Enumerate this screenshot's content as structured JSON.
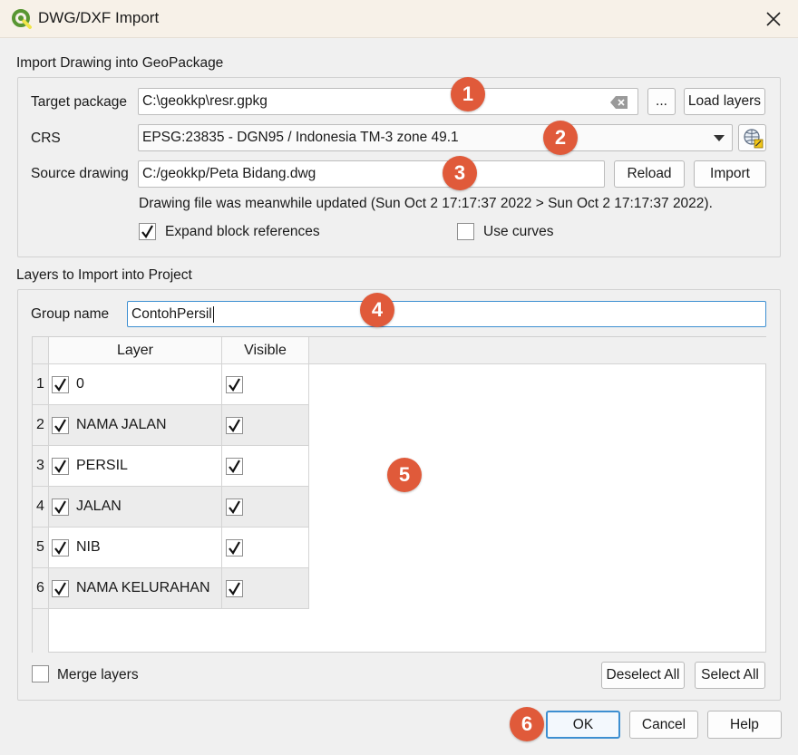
{
  "window": {
    "title": "DWG/DXF Import"
  },
  "icons": {
    "app": "qgis-logo-icon",
    "close": "close-icon",
    "clear": "clear-text-icon",
    "dropdown": "chevron-down-icon",
    "crs_select": "globe-crs-icon",
    "check": "checkmark-icon"
  },
  "colors": {
    "accent": "#3d8fd1",
    "badge": "#e05a3a",
    "qgis_green": "#589632"
  },
  "import_drawing": {
    "title": "Import Drawing into GeoPackage",
    "target_package_label": "Target package",
    "target_package_value": "C:\\geokkp\\resr.gpkg",
    "browse_label": "...",
    "load_layers_label": "Load layers",
    "crs_label": "CRS",
    "crs_value": "EPSG:23835 - DGN95 / Indonesia TM-3 zone 49.1",
    "source_drawing_label": "Source drawing",
    "source_drawing_value": "C:/geokkp/Peta Bidang.dwg",
    "reload_label": "Reload",
    "import_label": "Import",
    "status_message": "Drawing file was meanwhile updated (Sun Oct 2 17:17:37 2022 > Sun Oct 2 17:17:37 2022).",
    "expand_block_label": "Expand block references",
    "expand_block_checked": true,
    "use_curves_label": "Use curves",
    "use_curves_checked": false
  },
  "layers_section": {
    "title": "Layers to Import into Project",
    "group_name_label": "Group name",
    "group_name_value": "ContohPersil",
    "columns": [
      "Layer",
      "Visible"
    ],
    "rows": [
      {
        "num": "1",
        "name": "0",
        "selected": true,
        "visible": true
      },
      {
        "num": "2",
        "name": "NAMA JALAN",
        "selected": true,
        "visible": true
      },
      {
        "num": "3",
        "name": "PERSIL",
        "selected": true,
        "visible": true
      },
      {
        "num": "4",
        "name": "JALAN",
        "selected": true,
        "visible": true
      },
      {
        "num": "5",
        "name": "NIB",
        "selected": true,
        "visible": true
      },
      {
        "num": "6",
        "name": "NAMA KELURAHAN",
        "selected": true,
        "visible": true
      }
    ],
    "merge_layers_label": "Merge layers",
    "merge_layers_checked": false,
    "deselect_all_label": "Deselect All",
    "select_all_label": "Select All"
  },
  "footer": {
    "ok_label": "OK",
    "cancel_label": "Cancel",
    "help_label": "Help"
  },
  "annotations": [
    "1",
    "2",
    "3",
    "4",
    "5",
    "6"
  ]
}
